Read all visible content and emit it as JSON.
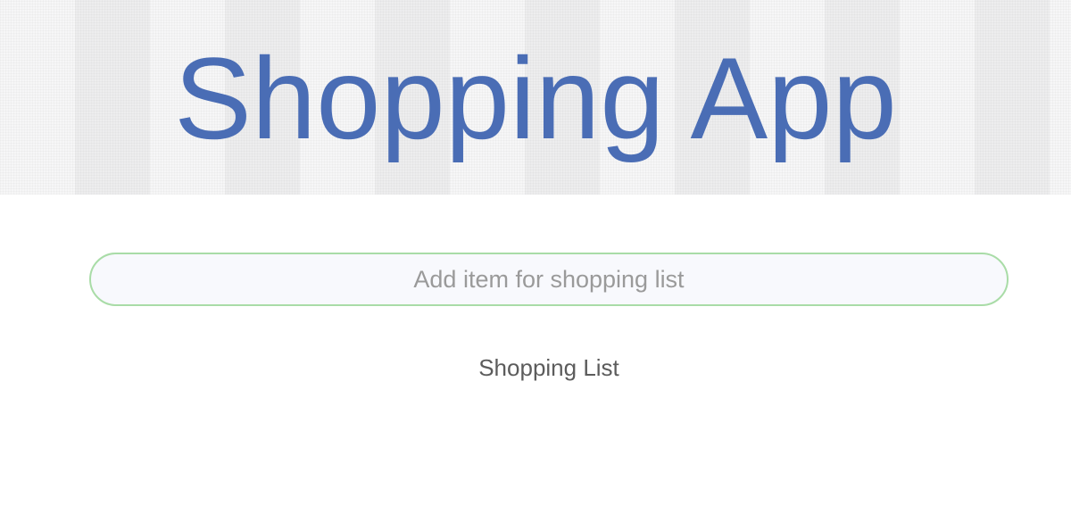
{
  "header": {
    "title": "Shopping App"
  },
  "add_item": {
    "value": "",
    "placeholder": "Add item for shopping list"
  },
  "list": {
    "heading": "Shopping List",
    "items": []
  },
  "colors": {
    "title": "#4a6db5",
    "input_border": "#a9dca7",
    "input_background": "#f8f9fd",
    "header_background": "#f2f2f3"
  }
}
